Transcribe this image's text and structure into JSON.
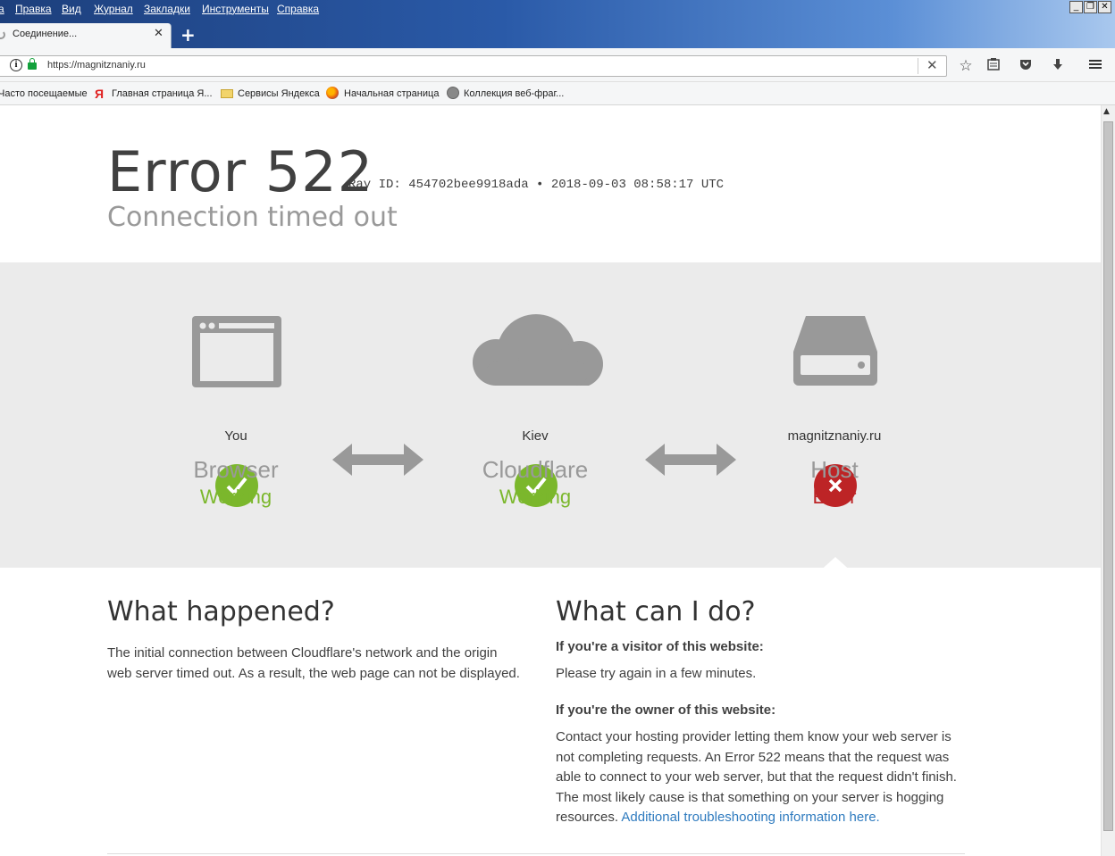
{
  "menubar": {
    "items": [
      "Правка",
      "Вид",
      "Журнал",
      "Закладки",
      "Инструменты",
      "Справка"
    ]
  },
  "tab": {
    "title": "Соединение..."
  },
  "urlbar": {
    "url": "https://magnitznaniy.ru"
  },
  "bookmarks": [
    "Часто посещаемые",
    "Главная страница Я...",
    "Сервисы Яндекса",
    "Начальная страница",
    "Коллекция веб-фраг..."
  ],
  "error": {
    "title": "Error 522",
    "ray": "Ray ID: 454702bee9918ada • 2018-09-03 08:58:17 UTC",
    "subtitle": "Connection timed out"
  },
  "nodes": [
    {
      "location": "You",
      "name": "Browser",
      "status": "Working",
      "icon": "browser-icon",
      "state": "ok"
    },
    {
      "location": "Kiev",
      "name": "Cloudflare",
      "status": "Working",
      "icon": "cloud-icon",
      "state": "ok"
    },
    {
      "location": "magnitznaniy.ru",
      "name": "Host",
      "status": "Error",
      "icon": "server-icon",
      "state": "error"
    }
  ],
  "colors": {
    "ok": "#7bb72c",
    "error": "#bd2426",
    "link": "#2f7bbf"
  },
  "what_happened": {
    "title": "What happened?",
    "text": "The initial connection between Cloudflare's network and the origin web server timed out. As a result, the web page can not be displayed."
  },
  "what_can_i_do": {
    "title": "What can I do?",
    "visitor_heading": "If you're a visitor of this website:",
    "visitor_text": "Please try again in a few minutes.",
    "owner_heading": "If you're the owner of this website:",
    "owner_text": "Contact your hosting provider letting them know your web server is not completing requests. An Error 522 means that the request was able to connect to your web server, but that the request didn't finish. The most likely cause is that something on your server is hogging resources.",
    "owner_link": "Additional troubleshooting information here."
  }
}
